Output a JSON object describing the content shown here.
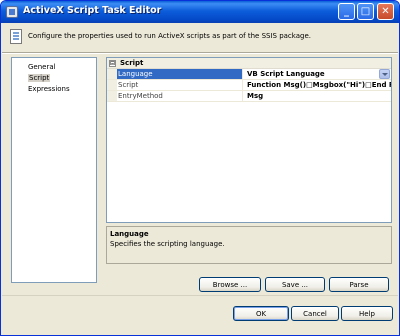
{
  "window": {
    "title": "ActiveX Script Task Editor"
  },
  "title_buttons": {
    "minimize": "_",
    "maximize": "□",
    "close": "✕"
  },
  "header": {
    "description": "Configure the properties used to run ActiveX scripts as part of the SSIS package."
  },
  "nav": {
    "items": [
      "General",
      "Script",
      "Expressions"
    ],
    "selected": "Script"
  },
  "grid": {
    "category": {
      "expander": "⊟",
      "label": "Script"
    },
    "rows": [
      {
        "name": "Language",
        "value": "VB Script Language"
      },
      {
        "name": "Script",
        "value": "Function Msg()□Msgbox(\"Hi\")□End Funct"
      },
      {
        "name": "EntryMethod",
        "value": "Msg"
      }
    ]
  },
  "description": {
    "title": "Language",
    "text": "Specifies the scripting language."
  },
  "buttons": {
    "browse": "Browse ...",
    "save": "Save ...",
    "parse": "Parse",
    "ok": "OK",
    "cancel": "Cancel",
    "help": "Help"
  },
  "colors": {
    "title_bar": "#0a5fd8",
    "selection": "#316ac5",
    "window_bg": "#ece9d8"
  },
  "icons": [
    "app-icon",
    "script-page-icon",
    "dropdown-arrow-icon"
  ]
}
